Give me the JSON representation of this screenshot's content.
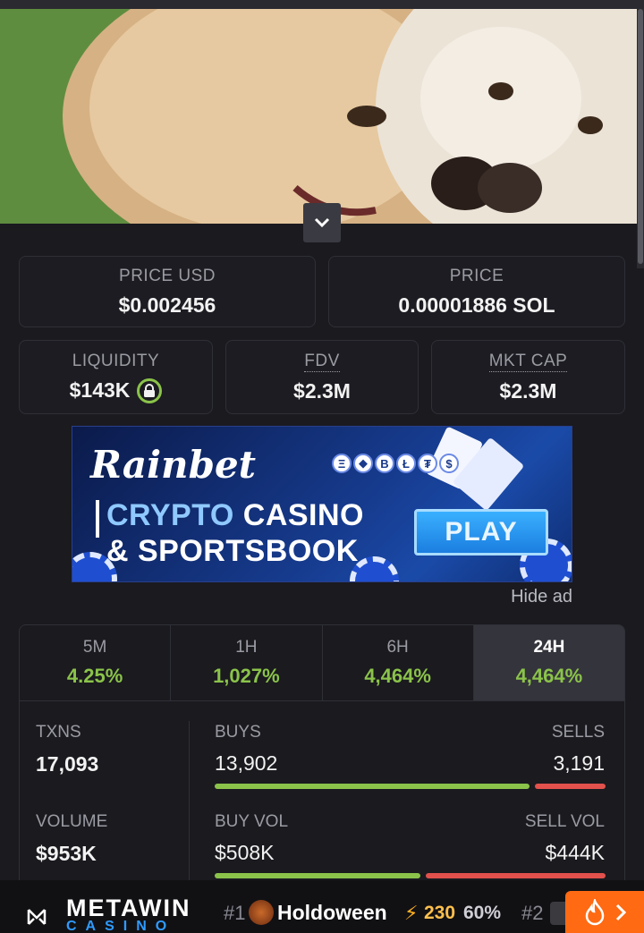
{
  "stats_top": {
    "price_usd": {
      "label": "PRICE USD",
      "value": "$0.002456"
    },
    "price_sol": {
      "label": "PRICE",
      "value": "0.00001886 SOL"
    },
    "liquidity": {
      "label": "LIQUIDITY",
      "value": "$143K"
    },
    "fdv": {
      "label": "FDV",
      "value": "$2.3M"
    },
    "mkt_cap": {
      "label": "MKT CAP",
      "value": "$2.3M"
    }
  },
  "ad": {
    "brand": "Rainbet",
    "line1_part1": "CRYPTO",
    "line1_part2": "CASINO",
    "line2": "& SPORTSBOOK",
    "cta": "PLAY",
    "coins": [
      "Ξ",
      "◆",
      "B",
      "Ł",
      "₮",
      "$"
    ],
    "hide_label": "Hide ad"
  },
  "tabs": [
    {
      "label": "5M",
      "change": "4.25%"
    },
    {
      "label": "1H",
      "change": "1,027%"
    },
    {
      "label": "6H",
      "change": "4,464%"
    },
    {
      "label": "24H",
      "change": "4,464%"
    }
  ],
  "txns": {
    "label": "TXNS",
    "value": "17,093",
    "buys_label": "BUYS",
    "buys": "13,902",
    "sells_label": "SELLS",
    "sells": "3,191",
    "buy_fraction": 0.813
  },
  "volume": {
    "label": "VOLUME",
    "value": "$953K",
    "buy_vol_label": "BUY VOL",
    "buy_vol": "$508K",
    "sell_vol_label": "SELL VOL",
    "sell_vol": "$444K",
    "buy_fraction": 0.534
  },
  "footer": {
    "brand": "METAWIN",
    "brand_sub": "CASINO",
    "rank1": "#1",
    "game_name": "Holdoween",
    "bolt": "⚡",
    "count": "230",
    "percent": "60%",
    "rank2": "#2"
  },
  "colors": {
    "positive": "#8bc34a",
    "negative": "#e2514c",
    "accent": "#ff6a13"
  }
}
